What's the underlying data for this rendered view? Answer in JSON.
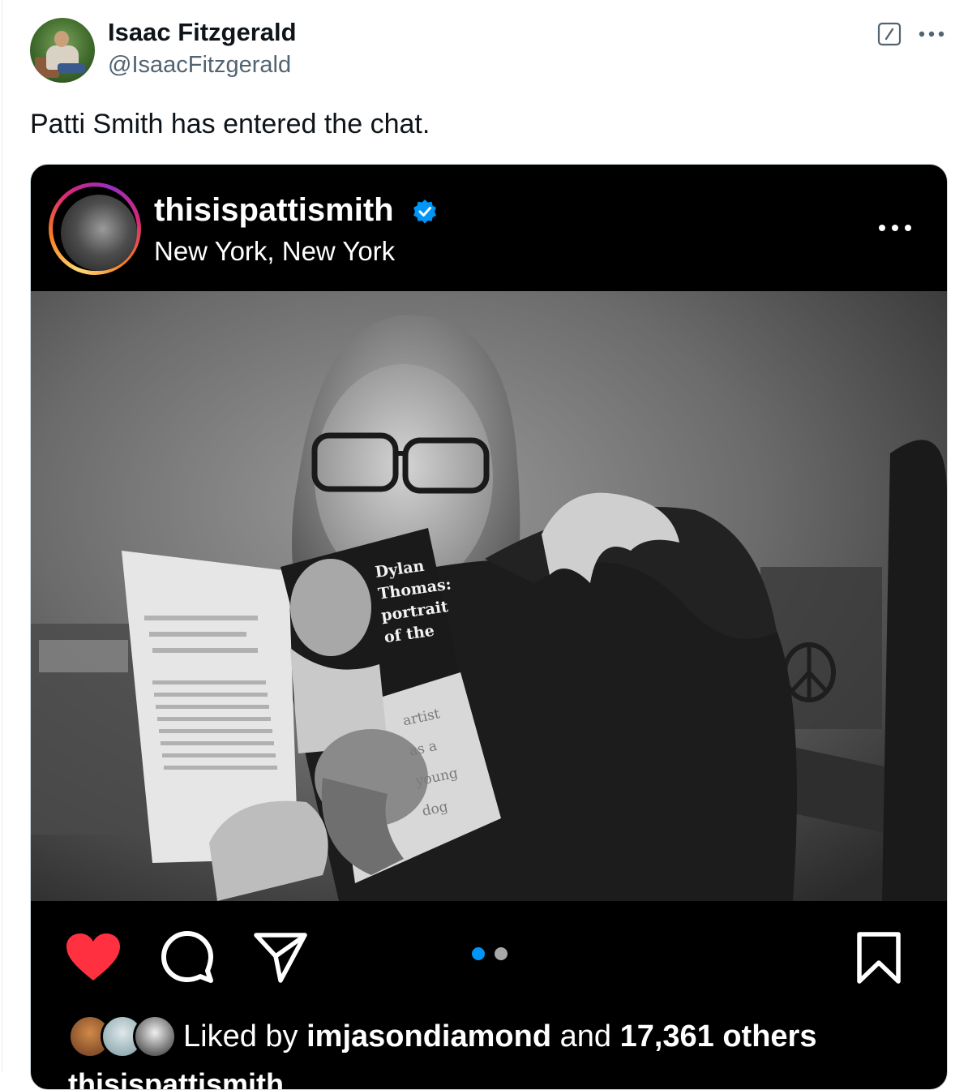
{
  "tweet": {
    "author": {
      "display_name": "Isaac Fitzgerald",
      "handle": "@IsaacFitzgerald"
    },
    "text": "Patti Smith has entered the chat.",
    "icons": {
      "edit": "edit-square-icon",
      "more": "more-horizontal-icon"
    }
  },
  "instagram_post": {
    "username": "thisispattismith",
    "verified": true,
    "location": "New York, New York",
    "photo": {
      "book_cover_text": [
        "Dylan",
        "Thomas:",
        "portrait",
        "of the",
        "artist",
        "as a",
        "young",
        "dog"
      ]
    },
    "actions": {
      "like": "heart-icon",
      "comment": "comment-icon",
      "share": "send-icon",
      "save": "bookmark-icon"
    },
    "carousel": {
      "count": 2,
      "active_index": 0
    },
    "likes": {
      "prefix": "Liked by",
      "user": "imjasondiamond",
      "joiner": "and",
      "others": "17,361 others"
    },
    "colors": {
      "heart": "#ff3040",
      "verified": "#0095f6",
      "active_dot": "#0095f6",
      "inactive_dot": "#a8a8a8"
    }
  }
}
